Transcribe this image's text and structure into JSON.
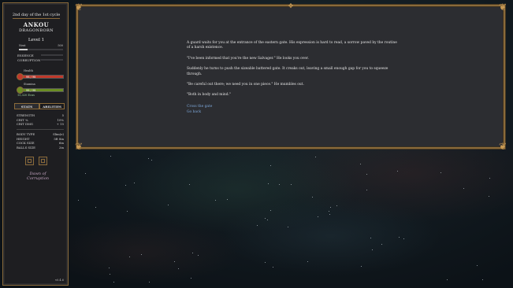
{
  "sidebar": {
    "day": "2nd day of the 1st cycle",
    "name": "ANKOU",
    "race": "DRAGONBORN",
    "level": "Level 1",
    "xp": {
      "label": "Next",
      "value": "500",
      "progress": 0.2
    },
    "essence_label": "ESSENCE",
    "corruption_label": "CORRUPTION",
    "health": {
      "caption": "Health",
      "value": "98 / 98",
      "fraction": 1.0,
      "color": "#c0392b"
    },
    "mana": {
      "caption": "Stamina",
      "value": "98 / 98",
      "fraction": 1.0,
      "color": "#6b8e23"
    },
    "money": "15,320 Ecus",
    "tabs": {
      "stats": "STATS",
      "abilities": "ABILITIES"
    },
    "combat_stats": [
      {
        "label": "STRENGTH",
        "value": "5"
      },
      {
        "label": "CRIT %",
        "value": "10%"
      },
      {
        "label": "CRIT DMG",
        "value": "+ 15"
      }
    ],
    "body_stats": [
      {
        "label": "BODY TYPE",
        "value": "Slim(e)"
      },
      {
        "label": "HEIGHT",
        "value": "5ft 8in"
      },
      {
        "label": "COCK SIZE",
        "value": "6in"
      },
      {
        "label": "BALLS SIZE",
        "value": "2in"
      }
    ],
    "logo_line1": "Dawn of",
    "logo_line2": "Corruption",
    "version": "v0.4.6"
  },
  "story": {
    "paragraphs": [
      "A guard waits for you at the entrance of the eastern gate. His expression is hard to read, a sorrow paved by the routine of a harsh existence.",
      "\"I've been informed that you're the new Salvager.\" He looks you over.",
      "Suddenly he turns to push the sizeable battered gate. It creaks out, leaving a small enough gap for you to squeeze through.",
      "\"Be careful out there; we need you in one piece.\" He mumbles out.",
      "\"Both in body and mind.\""
    ],
    "choices": [
      "Cross the gate",
      "Go back"
    ]
  },
  "colors": {
    "frame": "#8a6a3a",
    "panel": "#2c2d31",
    "link": "#7da7d9"
  }
}
